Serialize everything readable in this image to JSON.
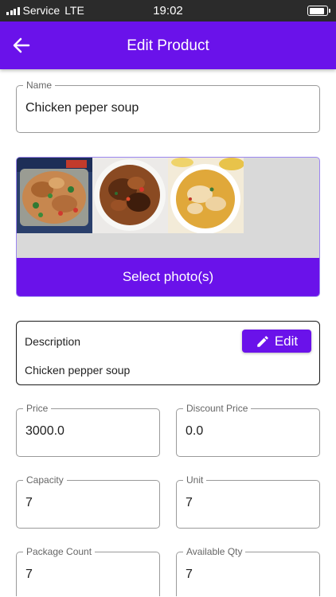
{
  "status": {
    "carrier": "Service",
    "network": "LTE",
    "time": "19:02",
    "signal_bars": 4,
    "battery_level": 0.8
  },
  "app_bar": {
    "title": "Edit Product",
    "back_icon": "arrow-back-icon"
  },
  "name_field": {
    "label": "Name",
    "value": "Chicken peper soup"
  },
  "photos": {
    "select_label": "Select photo(s)",
    "items": [
      "food-photo-1",
      "food-photo-2",
      "food-photo-3"
    ]
  },
  "description": {
    "label": "Description",
    "text": "Chicken pepper soup",
    "edit_label": "Edit",
    "edit_icon": "pencil-icon"
  },
  "fields": {
    "price": {
      "label": "Price",
      "value": "3000.0"
    },
    "discount_price": {
      "label": "Discount Price",
      "value": "0.0"
    },
    "capacity": {
      "label": "Capacity",
      "value": "7"
    },
    "unit": {
      "label": "Unit",
      "value": "7"
    },
    "package_count": {
      "label": "Package Count",
      "value": "7"
    },
    "available_qty": {
      "label": "Available Qty",
      "value": "7"
    }
  },
  "colors": {
    "primary": "#6a12ea",
    "status_bar": "#2b2b2b",
    "field_border": "#9a9a9a"
  }
}
